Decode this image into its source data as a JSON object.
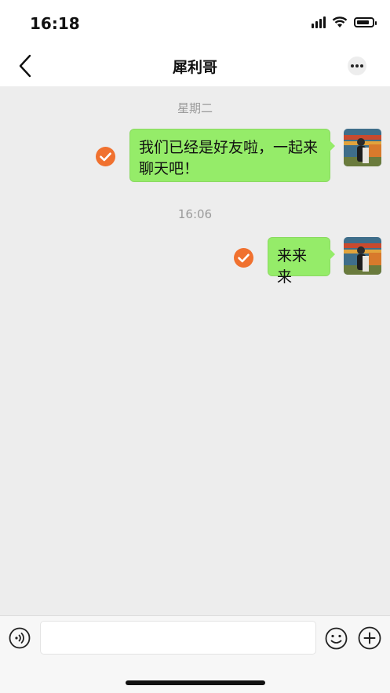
{
  "status_bar": {
    "time": "16:18",
    "battery_level": 0.85
  },
  "nav": {
    "title": "犀利哥",
    "back_icon": "chevron-left-icon",
    "more_icon": "more-dots-icon"
  },
  "messages": [
    {
      "timestamp": "星期二",
      "text_line1": "我们已经是好友啦，一起来",
      "text_line2": "聊天吧！",
      "status_icon": "check-circle-icon",
      "avatar_icon": "avatar-photo"
    },
    {
      "timestamp": "16:06",
      "text_line1": "来来来",
      "status_icon": "check-circle-icon",
      "avatar_icon": "avatar-photo"
    }
  ],
  "input_bar": {
    "voice_icon": "voice-icon",
    "input_value": "",
    "emoji_icon": "emoji-icon",
    "plus_icon": "plus-icon"
  },
  "colors": {
    "bubble": "#95ec69",
    "status_check": "#f0712f",
    "chat_background": "#ededed"
  }
}
